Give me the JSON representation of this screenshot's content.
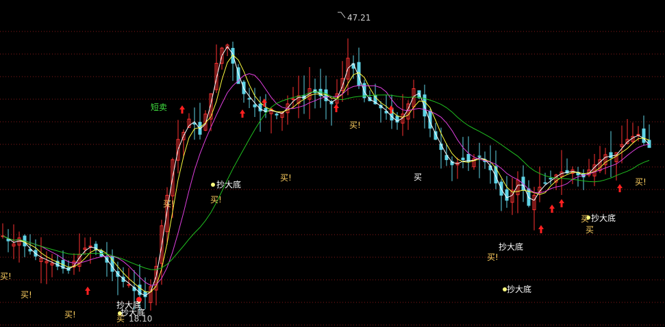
{
  "chart_data": {
    "type": "candlestick",
    "y_max_label": "47.21",
    "y_min_label": "18.10",
    "grid": "dotted-red-horizontal",
    "colors": {
      "background": "#000000",
      "grid": "#8b1a1a",
      "up_candle": "#ff3232",
      "down_candle": "#5fd3e6",
      "ma_short": "#ffffff",
      "ma_mid": "#ffff40",
      "ma_long": "#e040e0",
      "ma_longest": "#20c020",
      "buy_label": "#ffd060",
      "bottom_label": "#ffffff",
      "sell_label": "#40e040",
      "arrow": "#ff2020"
    },
    "series": [
      {
        "name": "price",
        "values": [
          26,
          25.5,
          25.2,
          25.8,
          25,
          24.5,
          24,
          23.8,
          23.5,
          23.3,
          23,
          22.8,
          22.6,
          23.5,
          24.2,
          24.8,
          25,
          24.6,
          24,
          23.4,
          22.5,
          22,
          21.5,
          21.2,
          20.6,
          20.2,
          20,
          21,
          23,
          27,
          30,
          33.5,
          35.5,
          36.2,
          37.5,
          37,
          36,
          38,
          40,
          43,
          44.5,
          44.8,
          43,
          41,
          40,
          39.5,
          38.7,
          38.3,
          38.2,
          38.5,
          37.9,
          38.2,
          39,
          39.5,
          39.8,
          39.5,
          40.5,
          40.1,
          39.8,
          39.3,
          39,
          40,
          41.5,
          43.5,
          42.5,
          40.8,
          39.6,
          39.3,
          39,
          38.6,
          38.1,
          37.4,
          37.2,
          38,
          39,
          40.5,
          39.6,
          37.8,
          36.6,
          35.5,
          34.5,
          33.5,
          33,
          33.2,
          33.5,
          33.3,
          33.6,
          33.8,
          33.3,
          32.5,
          31.2,
          30,
          29.5,
          30.5,
          31.5,
          30.5,
          29,
          30,
          30.8,
          31.2,
          31.6,
          32,
          32.3,
          32.2,
          32.5,
          32,
          31.8,
          32.5,
          33,
          33.5,
          34,
          33.7,
          34.2,
          35,
          35.5,
          35.8,
          36,
          35.2,
          34.7
        ]
      }
    ],
    "annotations": [
      {
        "text": "短卖",
        "kind": "sell"
      },
      {
        "text": "买!",
        "kind": "buy"
      },
      {
        "text": "买!",
        "kind": "buy"
      },
      {
        "text": "买!",
        "kind": "buy"
      },
      {
        "text": "买!",
        "kind": "buy"
      },
      {
        "text": "买!",
        "kind": "buy"
      },
      {
        "text": "买!",
        "kind": "buy"
      },
      {
        "text": "买!",
        "kind": "buy"
      },
      {
        "text": "买!",
        "kind": "buy"
      },
      {
        "text": "买!",
        "kind": "buy"
      },
      {
        "text": "买",
        "kind": "buy"
      },
      {
        "text": "买",
        "kind": "buy"
      },
      {
        "text": "买",
        "kind": "buy"
      },
      {
        "text": "抄大底",
        "kind": "bottom"
      },
      {
        "text": "抄大底",
        "kind": "bottom"
      },
      {
        "text": "抄大底",
        "kind": "bottom"
      },
      {
        "text": "抄大底",
        "kind": "bottom"
      },
      {
        "text": "抄大底",
        "kind": "bottom"
      },
      {
        "text": "抄大底",
        "kind": "bottom"
      },
      {
        "text": "买",
        "kind": "bottom"
      }
    ]
  }
}
